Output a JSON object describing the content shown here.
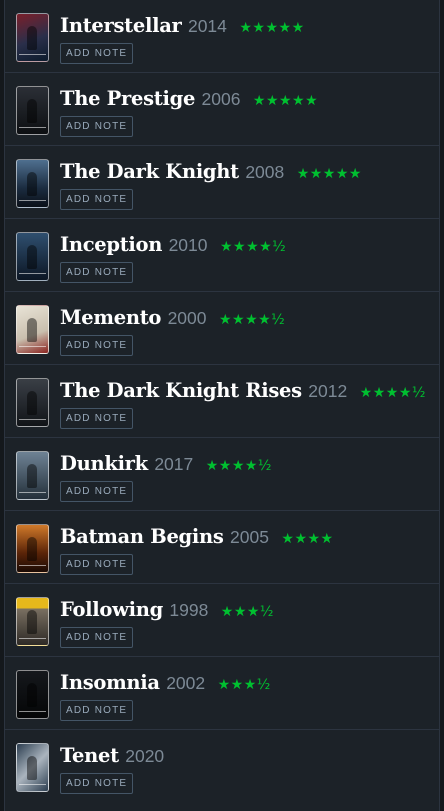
{
  "add_note_label": "ADD NOTE",
  "colors": {
    "star": "#00c030",
    "title": "#ffffff",
    "year": "#7d8a96"
  },
  "films": [
    {
      "title": "Interstellar",
      "year": "2014",
      "rating": "★★★★★",
      "poster_bg": "linear-gradient(160deg,#7a1f2a,#2a2f4a 55%,#0c1b2c)"
    },
    {
      "title": "The Prestige",
      "year": "2006",
      "rating": "★★★★★",
      "poster_bg": "linear-gradient(180deg,#2b2f36,#0d0f12)"
    },
    {
      "title": "The Dark Knight",
      "year": "2008",
      "rating": "★★★★★",
      "poster_bg": "linear-gradient(180deg,#4f6f8f,#1b2c40 60%,#0b1018)"
    },
    {
      "title": "Inception",
      "year": "2010",
      "rating": "★★★★½",
      "poster_bg": "linear-gradient(180deg,#2f4f6f,#0c1624)"
    },
    {
      "title": "Memento",
      "year": "2000",
      "rating": "★★★★½",
      "poster_bg": "linear-gradient(160deg,#e8e3d6,#c9bfae 60%,#8a2420)"
    },
    {
      "title": "The Dark Knight Rises",
      "year": "2012",
      "rating": "★★★★½",
      "poster_bg": "linear-gradient(180deg,#3a3f46,#111418)"
    },
    {
      "title": "Dunkirk",
      "year": "2017",
      "rating": "★★★★½",
      "poster_bg": "linear-gradient(180deg,#6e8294,#24303a)"
    },
    {
      "title": "Batman Begins",
      "year": "2005",
      "rating": "★★★★",
      "poster_bg": "linear-gradient(180deg,#d0792a,#5a2408 60%,#1a0a04)"
    },
    {
      "title": "Following",
      "year": "1998",
      "rating": "★★★½",
      "poster_bg": "linear-gradient(180deg,#e6b81c 0 22%,#7a7062 22%,#2e2a26)"
    },
    {
      "title": "Insomnia",
      "year": "2002",
      "rating": "★★★½",
      "poster_bg": "linear-gradient(180deg,#15181c,#050607)"
    },
    {
      "title": "Tenet",
      "year": "2020",
      "rating": "",
      "poster_bg": "linear-gradient(135deg,#2c3e50,#aab4be 50%,#2c3e50)"
    }
  ]
}
